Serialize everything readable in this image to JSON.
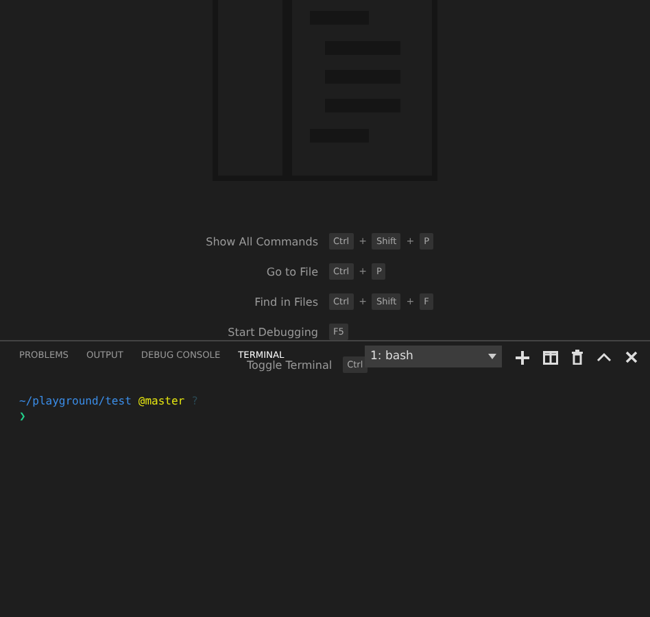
{
  "editor": {
    "separator": "+",
    "shortcuts": [
      {
        "label": "Show All Commands",
        "keys": [
          "Ctrl",
          "Shift",
          "P"
        ]
      },
      {
        "label": "Go to File",
        "keys": [
          "Ctrl",
          "P"
        ]
      },
      {
        "label": "Find in Files",
        "keys": [
          "Ctrl",
          "Shift",
          "F"
        ]
      },
      {
        "label": "Start Debugging",
        "keys": [
          "F5"
        ]
      },
      {
        "label": "Toggle Terminal",
        "keys": [
          "Ctrl"
        ]
      }
    ]
  },
  "panel": {
    "tabs": [
      {
        "label": "PROBLEMS",
        "selected": false
      },
      {
        "label": "OUTPUT",
        "selected": false
      },
      {
        "label": "DEBUG CONSOLE",
        "selected": false
      },
      {
        "label": "TERMINAL",
        "selected": true
      }
    ],
    "terminal_selector": {
      "value": "1: bash"
    }
  },
  "terminal": {
    "path": "~/playground/test",
    "branch": "@master",
    "status": "?",
    "prompt": "❯"
  }
}
